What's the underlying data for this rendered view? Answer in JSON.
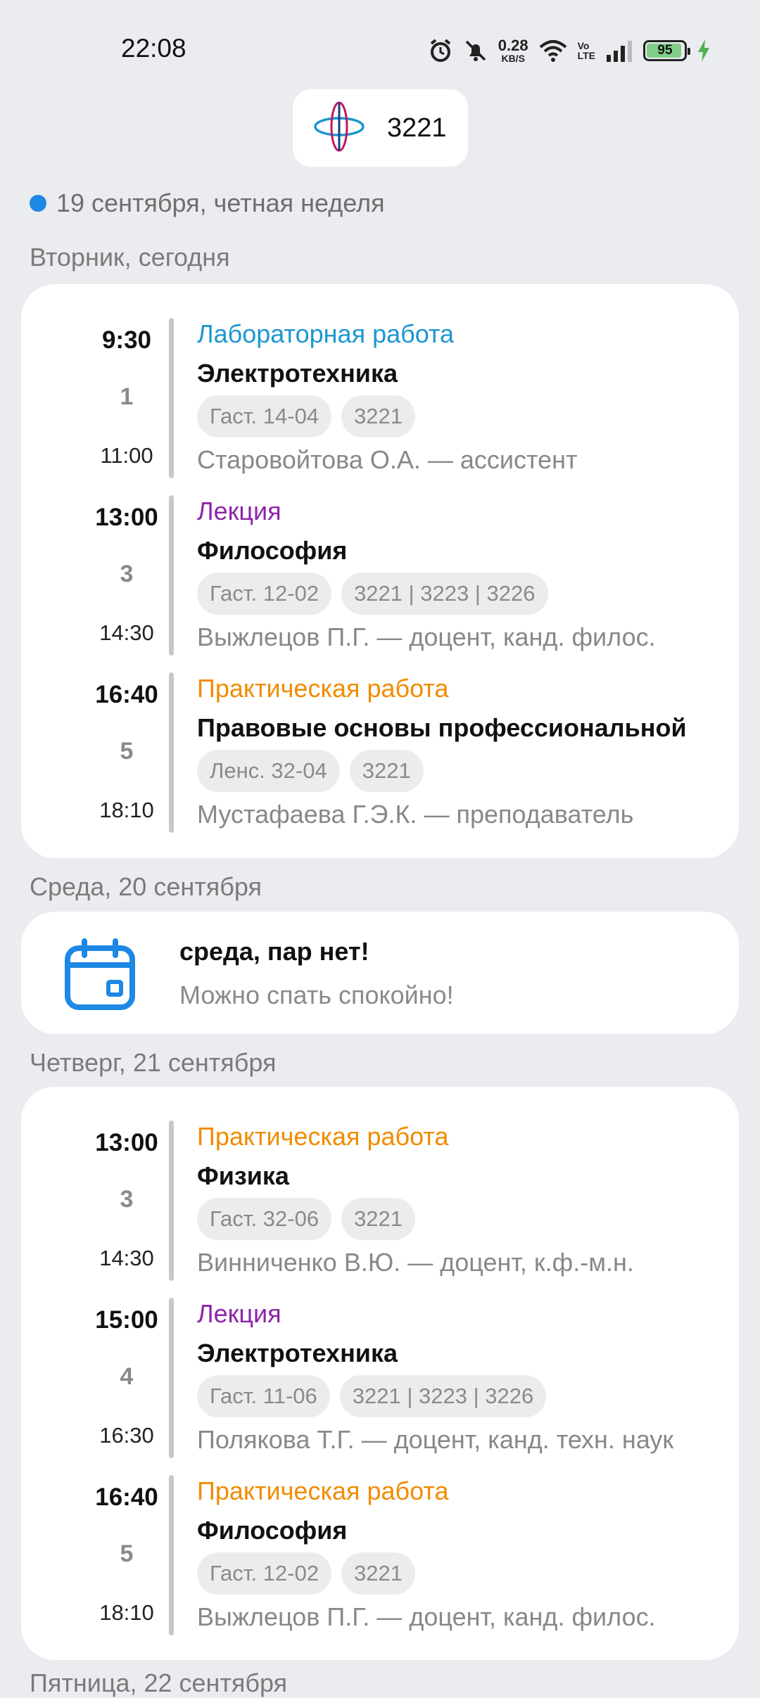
{
  "status_bar": {
    "time": "22:08",
    "net_speed_value": "0.28",
    "net_speed_unit": "KB/S",
    "volte_top": "Vo",
    "volte_bottom": "LTE",
    "battery": "95",
    "battery_level": 0.95,
    "icons": [
      "alarm-icon",
      "mute-icon",
      "wifi-icon",
      "signal-icon",
      "battery-icon",
      "charging-icon"
    ]
  },
  "header": {
    "group": "3221"
  },
  "week": {
    "text": "19 сентября, четная неделя",
    "dot_color": "#1e88e5"
  },
  "colors": {
    "lab": "#1b97d1",
    "lecture": "#8e24aa",
    "practice": "#f08c00"
  },
  "days": [
    {
      "title": "Вторник, сегодня",
      "lessons": [
        {
          "start": "9:30",
          "num": "1",
          "end": "11:00",
          "type": "Лабораторная работа",
          "subject": "Электротехника",
          "room": "Гаст. 14-04",
          "groups": "3221",
          "teacher": "Старовойтова О.А. — ассистент"
        },
        {
          "start": "13:00",
          "num": "3",
          "end": "14:30",
          "type": "Лекция",
          "subject": "Философия",
          "room": "Гаст. 12-02",
          "groups": "3221 | 3223 | 3226",
          "teacher": "Выжлецов П.Г. — доцент, канд. филос."
        },
        {
          "start": "16:40",
          "num": "5",
          "end": "18:10",
          "type": "Практическая работа",
          "subject": "Правовые основы профессиональной",
          "room": "Ленс. 32-04",
          "groups": "3221",
          "teacher": "Мустафаева Г.Э.К. — преподаватель"
        }
      ]
    },
    {
      "title": "Среда, 20 сентября",
      "no_classes": {
        "title": "среда, пар нет!",
        "subtitle": "Можно спать спокойно!"
      }
    },
    {
      "title": "Четверг, 21 сентября",
      "lessons": [
        {
          "start": "13:00",
          "num": "3",
          "end": "14:30",
          "type": "Практическая работа",
          "subject": "Физика",
          "room": "Гаст. 32-06",
          "groups": "3221",
          "teacher": "Винниченко В.Ю. — доцент, к.ф.-м.н."
        },
        {
          "start": "15:00",
          "num": "4",
          "end": "16:30",
          "type": "Лекция",
          "subject": "Электротехника",
          "room": "Гаст. 11-06",
          "groups": "3221 | 3223 | 3226",
          "teacher": "Полякова Т.Г. — доцент, канд. техн. наук"
        },
        {
          "start": "16:40",
          "num": "5",
          "end": "18:10",
          "type": "Практическая работа",
          "subject": "Философия",
          "room": "Гаст. 12-02",
          "groups": "3221",
          "teacher": "Выжлецов П.Г. — доцент, канд. филос."
        }
      ]
    },
    {
      "title": "Пятница, 22 сентября"
    }
  ]
}
